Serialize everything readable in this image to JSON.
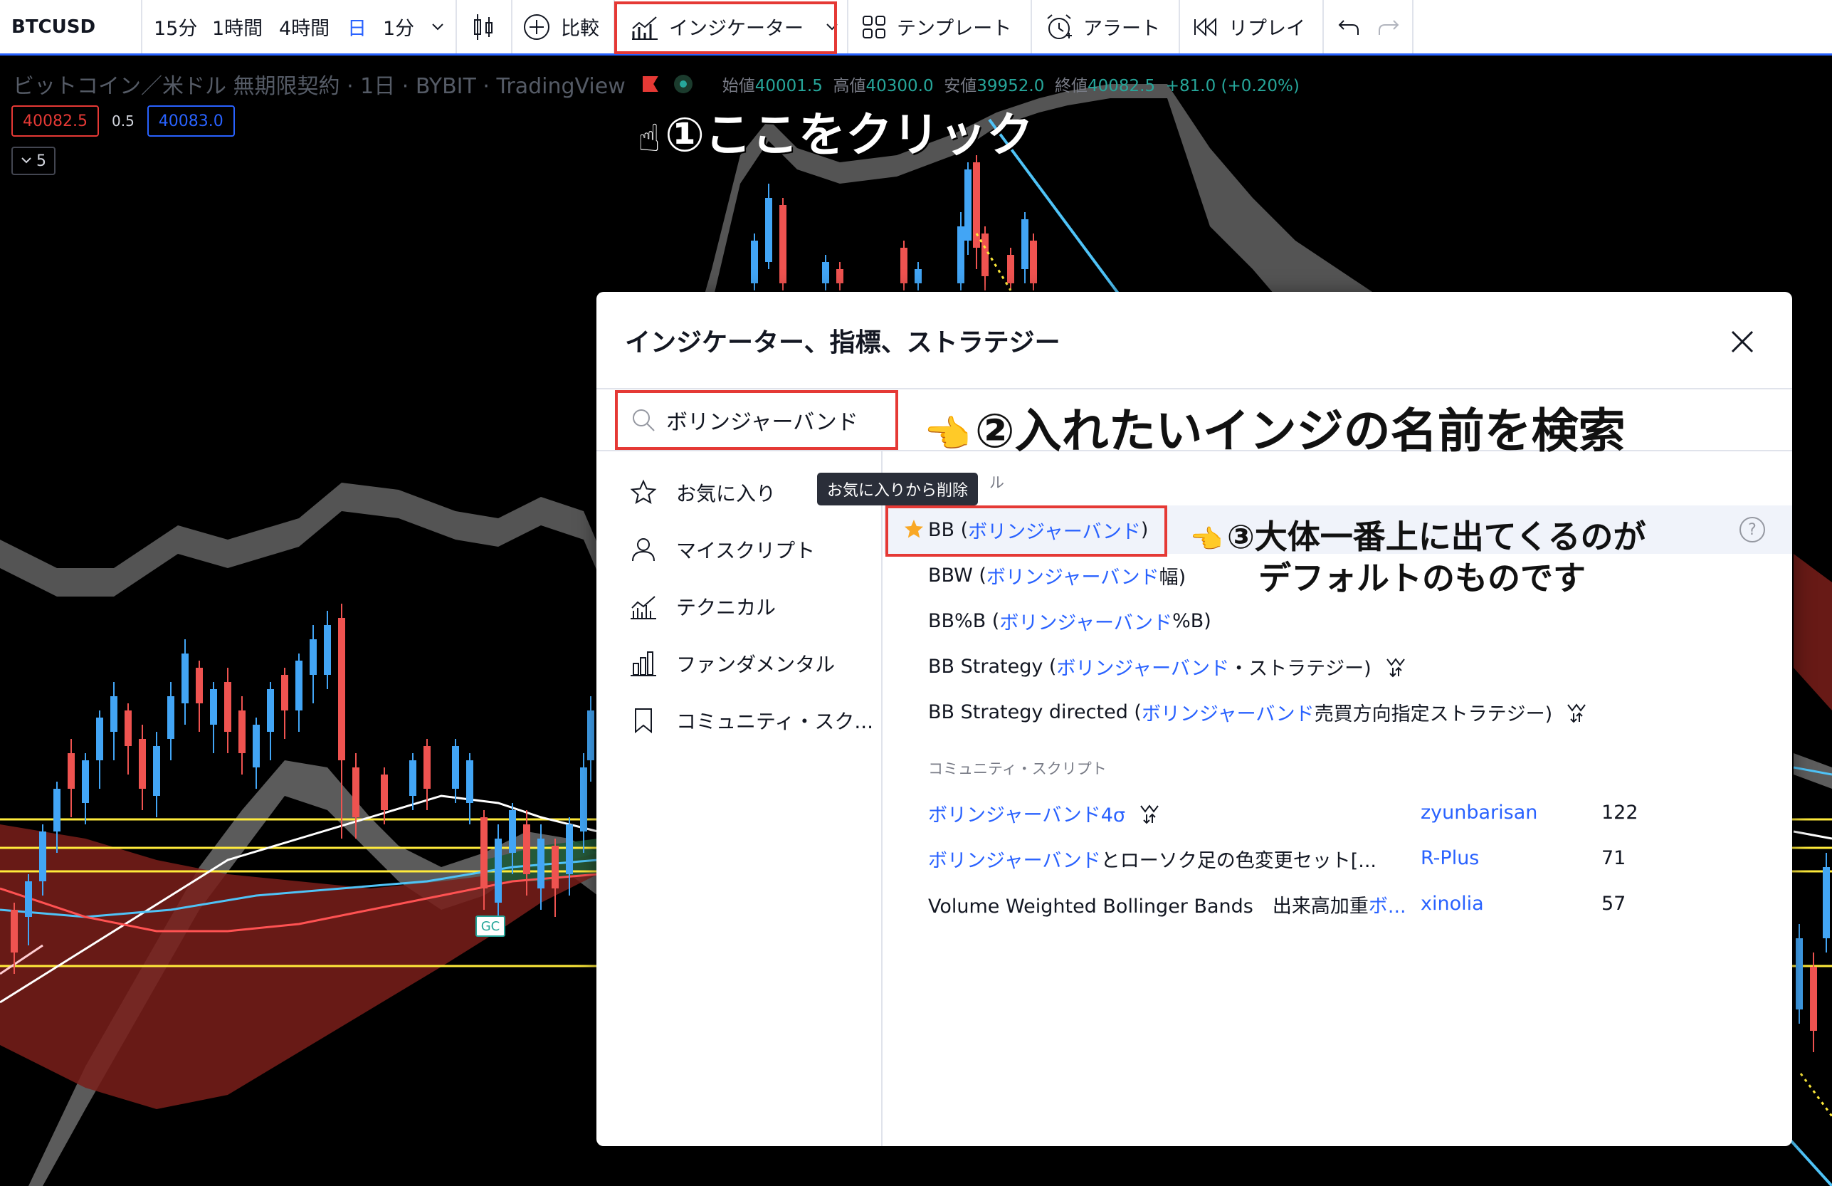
{
  "toolbar": {
    "symbol": "BTCUSD",
    "intervals": [
      "15分",
      "1時間",
      "4時間",
      "日",
      "1分"
    ],
    "compare_label": "比較",
    "indicators_label": "インジケーター",
    "templates_label": "テンプレート",
    "alert_label": "アラート",
    "replay_label": "リプレイ"
  },
  "legend": {
    "title": "ビットコイン／米ドル 無期限契約 · 1日 · BYBIT · TradingView",
    "open_label": "始値",
    "open": "40001.5",
    "high_label": "高値",
    "high": "40300.0",
    "low_label": "安値",
    "low": "39952.0",
    "close_label": "終値",
    "close": "40082.5",
    "change": "+81.0 (+0.20%)"
  },
  "price_badges": {
    "sell": "40082.5",
    "spread": "0.5",
    "buy": "40083.0"
  },
  "collapse_count": "5",
  "gc_label": "GC",
  "annotations": {
    "step1": "①ここをクリック",
    "step2": "②入れたいインジの名前を検索",
    "step3_line1": "③大体一番上に出てくるのが",
    "step3_line2": "デフォルトのものです"
  },
  "dialog": {
    "title": "インジケーター、指標、ストラテジー",
    "search_value": "ボリンジャーバンド",
    "categories": [
      "お気に入り",
      "マイスクリプト",
      "テクニカル",
      "ファンダメンタル",
      "コミュニティ・スク..."
    ],
    "tooltip": "お気に入りから削除",
    "tech_section_partial": "ル",
    "indicators": [
      {
        "prefix": "BB (",
        "name": "ボリンジャーバンド",
        "suffix": ")"
      },
      {
        "prefix": "BBW (",
        "name": "ボリンジャーバンド",
        "suffix": "幅)"
      },
      {
        "prefix": "BB%B (",
        "name": "ボリンジャーバンド",
        "suffix": "%B)"
      },
      {
        "prefix": "BB Strategy (",
        "name": "ボリンジャーバンド",
        "suffix": "・ストラテジー)"
      },
      {
        "prefix": "BB Strategy directed (",
        "name": "ボリンジャーバンド",
        "suffix": "売買方向指定ストラテジー)"
      }
    ],
    "community_section": "コミュニティ・スクリプト",
    "community": [
      {
        "name": "ボリンジャーバンド4σ",
        "rest": "",
        "author": "zyunbarisan",
        "likes": "122"
      },
      {
        "name": "ボリンジャーバンド",
        "rest": "とローソク足の色変更セット[...",
        "author": "R-Plus",
        "likes": "71"
      },
      {
        "name": "Volume Weighted Bollinger Bands　出来高加重",
        "rest": "ボ...",
        "author": "xinolia",
        "likes": "57"
      }
    ]
  }
}
